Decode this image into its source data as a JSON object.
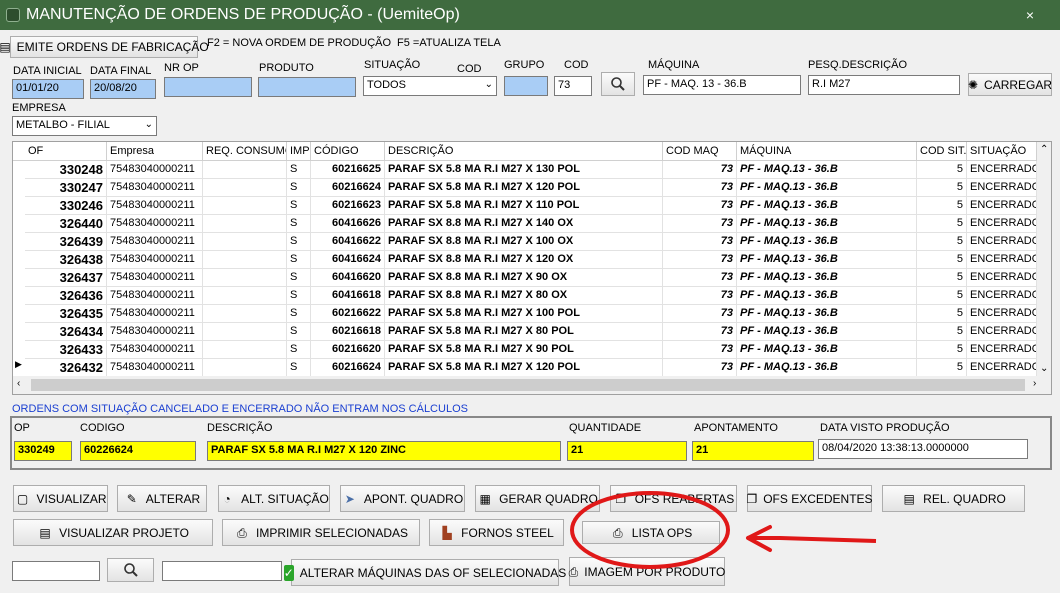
{
  "window": {
    "title": "MANUTENÇÃO DE ORDENS DE PRODUÇÃO - (UemiteOp)",
    "close_glyph": "×"
  },
  "toolbar": {
    "emit_button_label": "EMITE ORDENS DE FABRICAÇÃO",
    "hint_f2": "F2 = NOVA ORDEM DE PRODUÇÃO",
    "hint_f5": "F5 =ATUALIZA TELA"
  },
  "filters": {
    "data_inicial_label": "DATA INICIAL",
    "data_inicial_value": "01/01/20",
    "data_final_label": "DATA FINAL",
    "data_final_value": "20/08/20",
    "nr_op_label": "NR OP",
    "produto_label": "PRODUTO",
    "situacao_label": "SITUAÇÃO",
    "situacao_value": "TODOS",
    "cod_label": "COD",
    "grupo_label": "GRUPO",
    "cod2_label": "COD",
    "cod2_value": "73",
    "maquina_label": "MÁQUINA",
    "maquina_value": "PF - MAQ. 13 - 36.B",
    "pesq_label": "PESQ.DESCRIÇÃO",
    "pesq_value": "R.I M27",
    "carregar_label": "CARREGAR",
    "empresa_label": "EMPRESA",
    "empresa_value": "METALBO - FILIAL"
  },
  "grid": {
    "columns": [
      "OF",
      "Empresa",
      "REQ. CONSUMO",
      "IMP",
      "CÓDIGO",
      "DESCRIÇÃO",
      "COD MAQ",
      "MÁQUINA",
      "COD SIT.",
      "SITUAÇÃO"
    ],
    "rows": [
      {
        "of": "330248",
        "empresa": "75483040000211",
        "req": "",
        "imp": "S",
        "codigo": "60216625",
        "descricao": "PARAF SX 5.8 MA R.I M27 X 130 POL",
        "codmaq": "73",
        "maquina": "PF - MAQ.13 - 36.B",
        "codsit": "5",
        "situacao": "ENCERRADO"
      },
      {
        "of": "330247",
        "empresa": "75483040000211",
        "req": "",
        "imp": "S",
        "codigo": "60216624",
        "descricao": "PARAF SX 5.8 MA R.I M27 X 120 POL",
        "codmaq": "73",
        "maquina": "PF - MAQ.13 - 36.B",
        "codsit": "5",
        "situacao": "ENCERRADO"
      },
      {
        "of": "330246",
        "empresa": "75483040000211",
        "req": "",
        "imp": "S",
        "codigo": "60216623",
        "descricao": "PARAF SX 5.8 MA R.I M27 X 110 POL",
        "codmaq": "73",
        "maquina": "PF - MAQ.13 - 36.B",
        "codsit": "5",
        "situacao": "ENCERRADO"
      },
      {
        "of": "326440",
        "empresa": "75483040000211",
        "req": "",
        "imp": "S",
        "codigo": "60416626",
        "descricao": "PARAF SX 8.8 MA R.I M27 X 140 OX",
        "codmaq": "73",
        "maquina": "PF - MAQ.13 - 36.B",
        "codsit": "5",
        "situacao": "ENCERRADO"
      },
      {
        "of": "326439",
        "empresa": "75483040000211",
        "req": "",
        "imp": "S",
        "codigo": "60416622",
        "descricao": "PARAF SX 8.8 MA R.I M27 X 100 OX",
        "codmaq": "73",
        "maquina": "PF - MAQ.13 - 36.B",
        "codsit": "5",
        "situacao": "ENCERRADO"
      },
      {
        "of": "326438",
        "empresa": "75483040000211",
        "req": "",
        "imp": "S",
        "codigo": "60416624",
        "descricao": "PARAF SX 8.8 MA R.I M27 X 120 OX",
        "codmaq": "73",
        "maquina": "PF - MAQ.13 - 36.B",
        "codsit": "5",
        "situacao": "ENCERRADO"
      },
      {
        "of": "326437",
        "empresa": "75483040000211",
        "req": "",
        "imp": "S",
        "codigo": "60416620",
        "descricao": "PARAF SX 8.8 MA R.I M27 X 90 OX",
        "codmaq": "73",
        "maquina": "PF - MAQ.13 - 36.B",
        "codsit": "5",
        "situacao": "ENCERRADO"
      },
      {
        "of": "326436",
        "empresa": "75483040000211",
        "req": "",
        "imp": "S",
        "codigo": "60416618",
        "descricao": "PARAF SX 8.8 MA R.I M27 X 80 OX",
        "codmaq": "73",
        "maquina": "PF - MAQ.13 - 36.B",
        "codsit": "5",
        "situacao": "ENCERRADO"
      },
      {
        "of": "326435",
        "empresa": "75483040000211",
        "req": "",
        "imp": "S",
        "codigo": "60216622",
        "descricao": "PARAF SX 5.8 MA R.I M27 X 100 POL",
        "codmaq": "73",
        "maquina": "PF - MAQ.13 - 36.B",
        "codsit": "5",
        "situacao": "ENCERRADO"
      },
      {
        "of": "326434",
        "empresa": "75483040000211",
        "req": "",
        "imp": "S",
        "codigo": "60216618",
        "descricao": "PARAF SX 5.8 MA R.I M27 X 80 POL",
        "codmaq": "73",
        "maquina": "PF - MAQ.13 - 36.B",
        "codsit": "5",
        "situacao": "ENCERRADO"
      },
      {
        "of": "326433",
        "empresa": "75483040000211",
        "req": "",
        "imp": "S",
        "codigo": "60216620",
        "descricao": "PARAF SX 5.8 MA R.I M27 X 90 POL",
        "codmaq": "73",
        "maquina": "PF - MAQ.13 - 36.B",
        "codsit": "5",
        "situacao": "ENCERRADO"
      },
      {
        "of": "326432",
        "empresa": "75483040000211",
        "req": "",
        "imp": "S",
        "codigo": "60216624",
        "descricao": "PARAF SX 5.8 MA R.I M27 X 120 POL",
        "codmaq": "73",
        "maquina": "PF - MAQ.13 - 36.B",
        "codsit": "5",
        "situacao": "ENCERRADO"
      }
    ]
  },
  "notice": "ORDENS COM SITUAÇÃO CANCELADO E ENCERRADO NÃO ENTRAM NOS CÁLCULOS",
  "detail": {
    "op_label": "OP",
    "op_value": "330249",
    "codigo_label": "CODIGO",
    "codigo_value": "60226624",
    "descricao_label": "DESCRIÇÃO",
    "descricao_value": "PARAF SX 5.8 MA R.I M27 X 120 ZINC",
    "quantidade_label": "QUANTIDADE",
    "quantidade_value": "21",
    "apontamento_label": "APONTAMENTO",
    "apontamento_value": "21",
    "data_visto_label": "DATA VISTO PRODUÇÃO",
    "data_visto_value": "08/04/2020 13:38:13.0000000"
  },
  "actions": {
    "visualizar": "VISUALIZAR",
    "alterar": "ALTERAR",
    "alt_situacao": "ALT. SITUAÇÃO",
    "apont_quadro": "APONT. QUADRO",
    "gerar_quadro": "GERAR QUADRO",
    "ofs_reabertas": "OFS REABERTAS",
    "ofs_excedentes": "OFS EXCEDENTES",
    "rel_quadro": "REL. QUADRO",
    "visualizar_projeto": "VISUALIZAR PROJETO",
    "imprimir_selecionadas": "IMPRIMIR SELECIONADAS",
    "fornos_steel": "FORNOS STEEL",
    "lista_ops": "LISTA  OPS",
    "alterar_maquinas": "ALTERAR MÁQUINAS DAS OF SELECIONADAS",
    "imagem_produto": "IMAGEM POR PRODUTO"
  },
  "colors": {
    "titlebar": "#3f6b3f",
    "field_blue": "#a9cdf5",
    "highlight_yellow": "#ffff00",
    "annotation_red": "#e01818",
    "notice_blue": "#1a3fd1"
  }
}
